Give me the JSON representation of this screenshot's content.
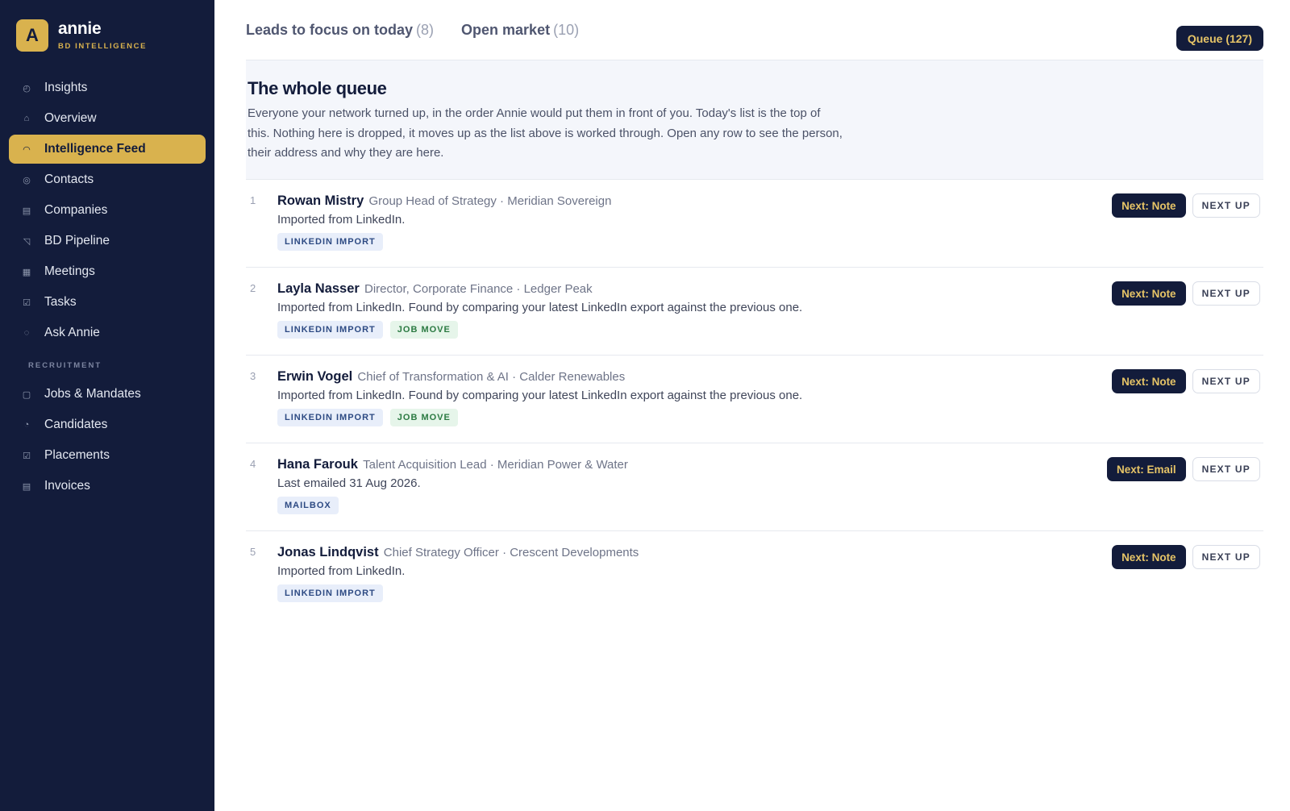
{
  "brand": {
    "logo_letter": "A",
    "name": "annie",
    "tagline": "BD INTELLIGENCE"
  },
  "nav": {
    "items": [
      {
        "label": "Insights",
        "icon": "clock-icon",
        "glyph": "◴",
        "active": false
      },
      {
        "label": "Overview",
        "icon": "home-icon",
        "glyph": "⌂",
        "active": false
      },
      {
        "label": "Intelligence Feed",
        "icon": "signal-icon",
        "glyph": "◠",
        "active": true
      },
      {
        "label": "Contacts",
        "icon": "target-icon",
        "glyph": "◎",
        "active": false
      },
      {
        "label": "Companies",
        "icon": "building-icon",
        "glyph": "▤",
        "active": false
      },
      {
        "label": "BD Pipeline",
        "icon": "funnel-icon",
        "glyph": "◹",
        "active": false
      },
      {
        "label": "Meetings",
        "icon": "calendar-icon",
        "glyph": "▦",
        "active": false
      },
      {
        "label": "Tasks",
        "icon": "checkbox-icon",
        "glyph": "☑",
        "active": false
      },
      {
        "label": "Ask Annie",
        "icon": "sparkle-icon",
        "glyph": "◌",
        "active": false
      }
    ],
    "section_label": "RECRUITMENT",
    "recruitment_items": [
      {
        "label": "Jobs & Mandates",
        "icon": "briefcase-icon",
        "glyph": "▢"
      },
      {
        "label": "Candidates",
        "icon": "person-icon",
        "glyph": "◔"
      },
      {
        "label": "Placements",
        "icon": "check-icon",
        "glyph": "☑"
      },
      {
        "label": "Invoices",
        "icon": "invoice-icon",
        "glyph": "▤"
      }
    ]
  },
  "tabs": [
    {
      "label": "Leads to focus on today",
      "count": "(8)"
    },
    {
      "label": "Open market",
      "count": "(10)"
    }
  ],
  "queue_button": "Queue (127)",
  "intro": {
    "title": "The whole queue",
    "description": "Everyone your network turned up, in the order Annie would put them in front of you. Today's list is the top of this. Nothing here is dropped, it moves up as the list above is worked through. Open any row to see the person, their address and why they are here."
  },
  "rows": [
    {
      "num": "1",
      "name": "Rowan Mistry",
      "meta": "Group Head of Strategy · Meridian Sovereign",
      "desc": "Imported from LinkedIn.",
      "tags": [
        {
          "label": "LINKEDIN IMPORT",
          "tone": "blue"
        }
      ],
      "next": "Next: Note",
      "up": "NEXT UP"
    },
    {
      "num": "2",
      "name": "Layla Nasser",
      "meta": "Director, Corporate Finance · Ledger Peak",
      "desc": "Imported from LinkedIn. Found by comparing your latest LinkedIn export against the previous one.",
      "tags": [
        {
          "label": "LINKEDIN IMPORT",
          "tone": "blue"
        },
        {
          "label": "JOB MOVE",
          "tone": "green"
        }
      ],
      "next": "Next: Note",
      "up": "NEXT UP"
    },
    {
      "num": "3",
      "name": "Erwin Vogel",
      "meta": "Chief of Transformation & AI · Calder Renewables",
      "desc": "Imported from LinkedIn. Found by comparing your latest LinkedIn export against the previous one.",
      "tags": [
        {
          "label": "LINKEDIN IMPORT",
          "tone": "blue"
        },
        {
          "label": "JOB MOVE",
          "tone": "green"
        }
      ],
      "next": "Next: Note",
      "up": "NEXT UP"
    },
    {
      "num": "4",
      "name": "Hana Farouk",
      "meta": "Talent Acquisition Lead · Meridian Power & Water",
      "desc": "Last emailed 31 Aug 2026.",
      "tags": [
        {
          "label": "MAILBOX",
          "tone": "blue"
        }
      ],
      "next": "Next: Email",
      "up": "NEXT UP"
    },
    {
      "num": "5",
      "name": "Jonas Lindqvist",
      "meta": "Chief Strategy Officer · Crescent Developments",
      "desc": "Imported from LinkedIn.",
      "tags": [
        {
          "label": "LINKEDIN IMPORT",
          "tone": "blue"
        }
      ],
      "next": "Next: Note",
      "up": "NEXT UP"
    }
  ],
  "colors": {
    "sidebar": "#131c3b",
    "accent": "#d9b24e",
    "tag_blue": "#e8eefa",
    "tag_green": "#e6f5ea"
  }
}
